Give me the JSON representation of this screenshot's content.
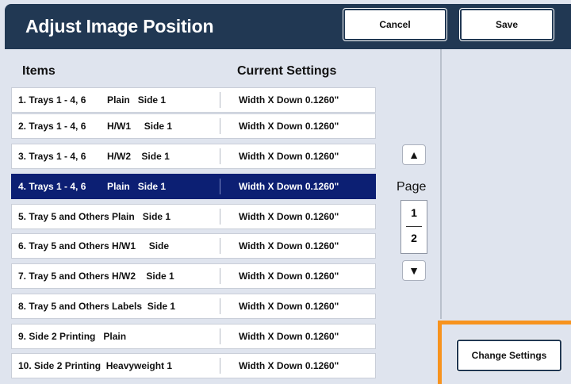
{
  "header": {
    "title": "Adjust Image Position",
    "cancel_label": "Cancel",
    "save_label": "Save"
  },
  "table": {
    "col_items": "Items",
    "col_settings": "Current Settings",
    "rows": [
      {
        "item": "1. Trays 1 - 4, 6        Plain   Side 1",
        "setting": "Width X Down 0.1260\"",
        "selected": false
      },
      {
        "item": "2. Trays 1 - 4, 6        H/W1     Side 1",
        "setting": "Width X Down 0.1260\"",
        "selected": false
      },
      {
        "item": "3. Trays 1 - 4, 6        H/W2    Side 1",
        "setting": "Width X Down 0.1260\"",
        "selected": false
      },
      {
        "item": "4. Trays 1 - 4, 6        Plain   Side 1",
        "setting": "Width X Down 0.1260\"",
        "selected": true
      },
      {
        "item": "5. Tray 5 and Others Plain   Side 1",
        "setting": "Width X Down 0.1260\"",
        "selected": false
      },
      {
        "item": "6. Tray 5 and Others H/W1     Side",
        "setting": "Width X Down 0.1260\"",
        "selected": false
      },
      {
        "item": "7. Tray 5 and Others H/W2    Side 1",
        "setting": "Width X Down 0.1260\"",
        "selected": false
      },
      {
        "item": "8. Tray 5 and Others Labels  Side 1",
        "setting": "Width X Down 0.1260\"",
        "selected": false
      },
      {
        "item": "9. Side 2 Printing   Plain",
        "setting": "Width X Down 0.1260\"",
        "selected": false
      },
      {
        "item": "10. Side 2 Printing  Heavyweight 1",
        "setting": "Width X Down 0.1260\"",
        "selected": false
      }
    ]
  },
  "pager": {
    "label": "Page",
    "current": "1",
    "total": "2",
    "up_icon": "triangle-up",
    "down_icon": "triangle-down"
  },
  "actions": {
    "change_settings_label": "Change Settings"
  },
  "colors": {
    "header_bg": "#213853",
    "selected_row": "#0c1f73",
    "highlight": "#f7931e",
    "panel_bg": "#dfe4ee"
  }
}
